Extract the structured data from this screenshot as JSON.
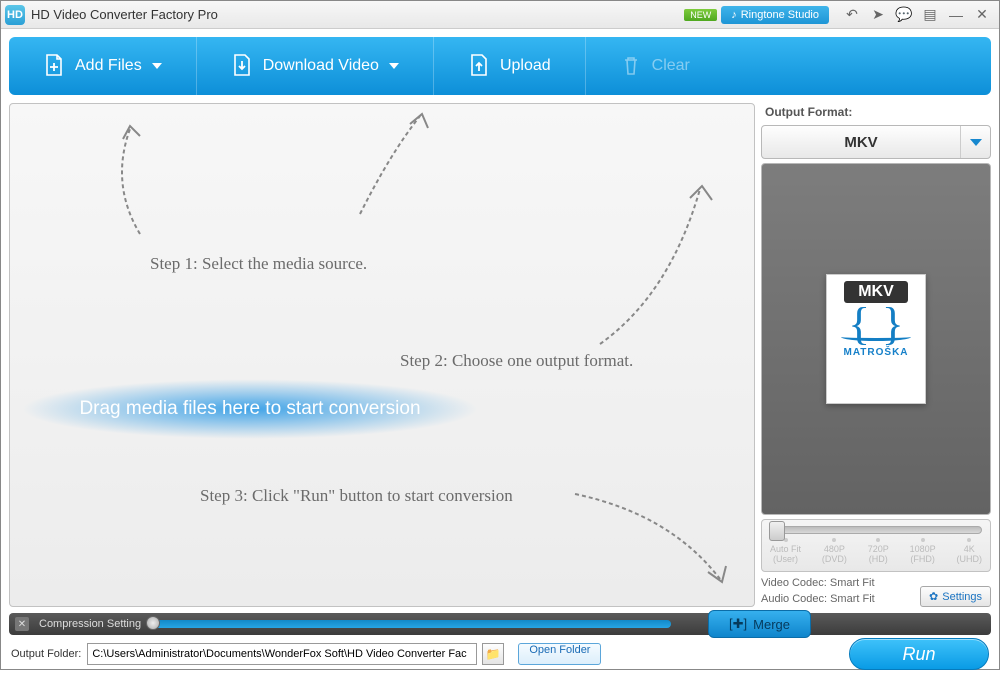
{
  "titlebar": {
    "app_title": "HD Video Converter Factory Pro",
    "new_badge": "NEW",
    "ringtone": "Ringtone Studio"
  },
  "toolbar": {
    "add_files": "Add Files",
    "download": "Download Video",
    "upload": "Upload",
    "clear": "Clear"
  },
  "steps": {
    "s1": "Step 1: Select the media source.",
    "s2": "Step 2: Choose one output format.",
    "s3": "Step 3: Click \"Run\" button to start conversion",
    "drag": "Drag media files here to start conversion"
  },
  "side": {
    "label": "Output Format:",
    "format": "MKV",
    "card_head": "MKV",
    "card_name": "MATROŠKA",
    "res": [
      {
        "t": "Auto Fit",
        "b": "(User)"
      },
      {
        "t": "480P",
        "b": "(DVD)"
      },
      {
        "t": "720P",
        "b": "(HD)"
      },
      {
        "t": "1080P",
        "b": "(FHD)"
      },
      {
        "t": "4K",
        "b": "(UHD)"
      }
    ],
    "video_codec": "Video Codec: Smart Fit",
    "audio_codec": "Audio Codec: Smart Fit",
    "settings": "Settings"
  },
  "compress": {
    "label": "Compression Setting",
    "merge": "Merge"
  },
  "bottom": {
    "label": "Output Folder:",
    "path": "C:\\Users\\Administrator\\Documents\\WonderFox Soft\\HD Video Converter Fac",
    "open": "Open Folder",
    "run": "Run"
  }
}
